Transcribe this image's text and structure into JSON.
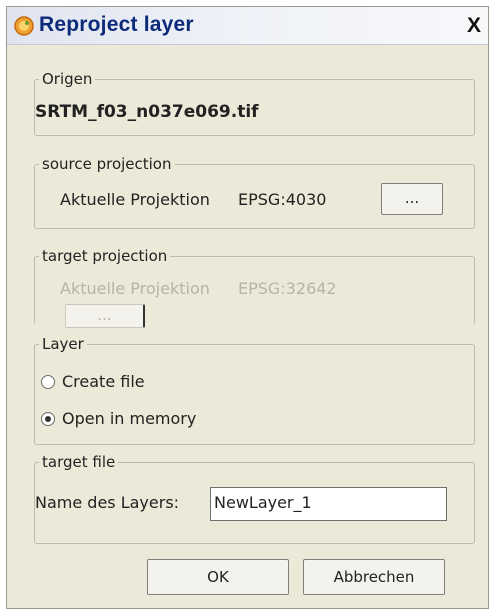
{
  "window": {
    "title": "Reproject layer",
    "close_label": "X"
  },
  "origin": {
    "legend": "Origen",
    "file_name": "SRTM_f03_n037e069.tif"
  },
  "source_projection": {
    "legend": "source projection",
    "label": "Aktuelle Projektion",
    "value": "EPSG:4030",
    "browse_label": "..."
  },
  "target_projection": {
    "legend": "target projection",
    "label": "Aktuelle Projektion",
    "value": "EPSG:32642",
    "browse_label": "..."
  },
  "layer": {
    "legend": "Layer",
    "options": [
      {
        "label": "Create file",
        "selected": false
      },
      {
        "label": "Open in memory",
        "selected": true
      }
    ]
  },
  "target_file": {
    "legend": "target file",
    "name_label": "Name des Layers:",
    "name_value": "NewLayer_1"
  },
  "buttons": {
    "ok": "OK",
    "cancel": "Abbrechen"
  }
}
